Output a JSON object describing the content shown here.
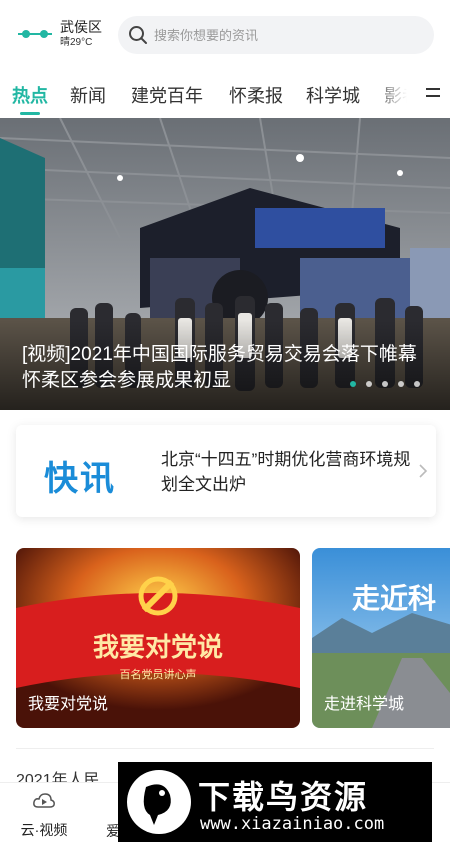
{
  "header": {
    "location": "武侯区",
    "weather": "晴29°C",
    "search_placeholder": "搜索你想要的资讯"
  },
  "tabs": [
    {
      "label": "热点",
      "active": true
    },
    {
      "label": "新闻",
      "active": false
    },
    {
      "label": "建党百年",
      "active": false
    },
    {
      "label": "怀柔报",
      "active": false
    },
    {
      "label": "科学城",
      "active": false
    },
    {
      "label": "影者",
      "active": false
    }
  ],
  "banner": {
    "title": "[视频]2021年中国国际服务贸易交易会落下帷幕怀柔区参会参展成果初显",
    "dots_total": 5,
    "dots_active_index": 0
  },
  "flash": {
    "logo": "快讯",
    "text": "北京“十四五”时期优化营商环境规划全文出炉"
  },
  "cards": [
    {
      "label": "我要对党说",
      "art_text": "我要对党说",
      "art_sub": "百名党员讲心声"
    },
    {
      "label": "走进科学城",
      "art_text": "走近科"
    }
  ],
  "partial_text": "2021年人民",
  "bottom_nav": {
    "video_label": "云·视频",
    "item2_label": "爱"
  },
  "watermark": {
    "title": "下载鸟资源",
    "url": "www.xiazainiao.com"
  },
  "colors": {
    "accent": "#22b7a3",
    "flash_blue": "#1a8cd8",
    "card_red": "#d81e1e"
  }
}
